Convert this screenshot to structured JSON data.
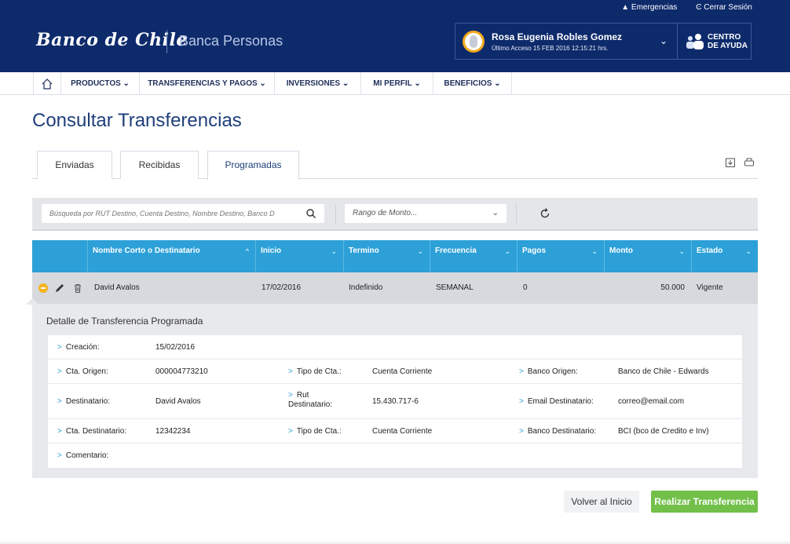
{
  "topbar": {
    "emergencias": "▲ Emergencias",
    "cerrar": "Ͼ Cerrar Sesión"
  },
  "header": {
    "logo": "Banco de Chile",
    "subtitle": "Banca Personas",
    "user_name": "Rosa Eugenia Robles Gomez",
    "user_access": "Último Acceso 15 FEB 2016 12:15:21 hrs.",
    "help_label_1": "CENTRO",
    "help_label_2": "DE AYUDA"
  },
  "nav": {
    "items": [
      "PRODUCTOS ⌄",
      "TRANSFERENCIAS Y PAGOS ⌄",
      "INVERSIONES ⌄",
      "MI PERFIL ⌄",
      "BENEFICIOS ⌄"
    ]
  },
  "page": {
    "title": "Consultar Transferencias"
  },
  "tabs": [
    "Enviadas",
    "Recibidas",
    "Programadas"
  ],
  "active_tab": "Programadas",
  "filters": {
    "search_placeholder": "Búsqueda por RUT Destino, Cuenta Destino, Nombre Destino, Banco D",
    "range_label": "Rango de Monto..."
  },
  "table": {
    "columns": [
      "Nombre Corto o Destinatario",
      "Inicio",
      "Termino",
      "Frecuencia",
      "Pagos",
      "Monto",
      "Estado"
    ],
    "row": {
      "nombre": "David Avalos",
      "inicio": "17/02/2016",
      "termino": "Indefinido",
      "frecuencia": "SEMANAL",
      "pagos": "0",
      "monto": "50.000",
      "estado": "Vigente"
    }
  },
  "detail": {
    "title": "Detalle de Transferencia Programada",
    "creacion_label": "Creación:",
    "creacion": "15/02/2016",
    "cta_origen_label": "Cta. Origen:",
    "cta_origen": "000004773210",
    "tipo_cta_label": "Tipo de Cta.:",
    "tipo_cta_origen": "Cuenta Corriente",
    "banco_origen_label": "Banco Origen:",
    "banco_origen": "Banco de Chile - Edwards",
    "destinatario_label": "Destinatario:",
    "destinatario": "David Avalos",
    "rut_label_1": "Rut",
    "rut_label_2": "Destinatario:",
    "rut": "15.430.717-6",
    "email_label": "Email Destinatario:",
    "email": "correo@email.com",
    "cta_dest_label": "Cta. Destinatario:",
    "cta_dest": "12342234",
    "tipo_cta_dest": "Cuenta Corriente",
    "banco_dest_label": "Banco Destinatario:",
    "banco_dest": "BCI (bco de Credito e Inv)",
    "comentario_label": "Comentario:"
  },
  "buttons": {
    "volver": "Volver al Inicio",
    "realizar": "Realizar Transferencia"
  },
  "colors": {
    "header": "#0d2a6b",
    "table_header": "#2da0d8",
    "primary_button": "#72c04a",
    "accent": "#f5b31c"
  }
}
